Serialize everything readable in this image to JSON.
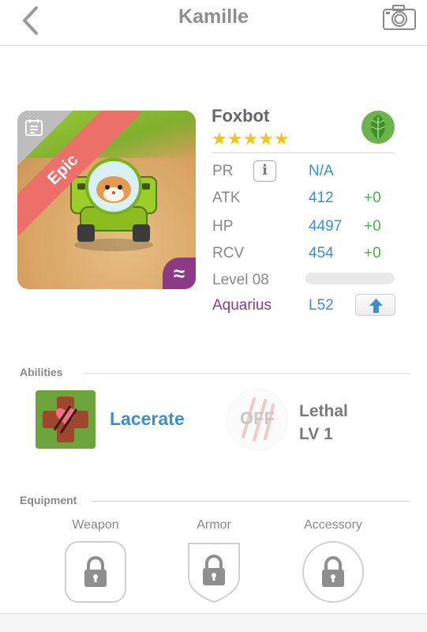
{
  "header": {
    "title": "Kamille",
    "back_icon": "chevron-left-icon",
    "camera_icon": "camera-icon"
  },
  "card": {
    "rarity": "Epic",
    "tribe_symbol": "≈",
    "name": "Foxbot",
    "stars": "★★★★★",
    "star_count": 5,
    "element_icon": "leaf-icon",
    "colors": {
      "rarity": "#ec6f6a",
      "tribe": "#8b3a86",
      "stat_value": "#3a8fd0",
      "bonus": "#4caf50",
      "star": "#f4c417"
    }
  },
  "stats": {
    "pr": {
      "label": "PR",
      "info": "i",
      "value": "N/A"
    },
    "atk": {
      "label": "ATK",
      "value": "412",
      "bonus": "+0"
    },
    "hp": {
      "label": "HP",
      "value": "4497",
      "bonus": "+0"
    },
    "rcv": {
      "label": "RCV",
      "value": "454",
      "bonus": "+0"
    },
    "level": {
      "label": "Level 08",
      "progress": 0
    },
    "sign": {
      "label": "Aquarius",
      "value": "L52",
      "upgrade_icon": "arrow-up-icon"
    }
  },
  "abilities": {
    "section_label": "Abilities",
    "items": [
      {
        "name": "Lacerate",
        "icon": "lacerate-icon"
      },
      {
        "name_line1": "Lethal",
        "name_line2": "LV 1",
        "badge": "OFF",
        "icon": "claw-marks-icon"
      }
    ]
  },
  "equipment": {
    "section_label": "Equipment",
    "slots": [
      {
        "label": "Weapon",
        "icon": "lock-icon"
      },
      {
        "label": "Armor",
        "icon": "lock-icon"
      },
      {
        "label": "Accessory",
        "icon": "lock-icon"
      }
    ]
  }
}
